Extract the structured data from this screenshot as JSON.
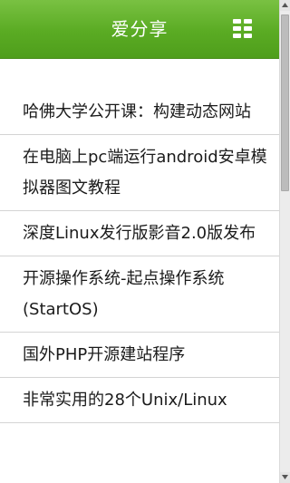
{
  "header": {
    "title": "爱分享",
    "menu_icon": "grid-menu-icon",
    "background_color": "#5aab23"
  },
  "articles": [
    {
      "title": "哈佛大学公开课：构建动态网站"
    },
    {
      "title": "在电脑上pc端运行android安卓模拟器图文教程"
    },
    {
      "title": "深度Linux发行版影音2.0版发布"
    },
    {
      "title": "开源操作系统-起点操作系统(StartOS)"
    },
    {
      "title": "国外PHP开源建站程序"
    },
    {
      "title": "非常实用的28个Unix/Linux"
    }
  ],
  "scrollbar": {
    "position_fraction": 0.0,
    "visible_fraction": 0.39
  }
}
